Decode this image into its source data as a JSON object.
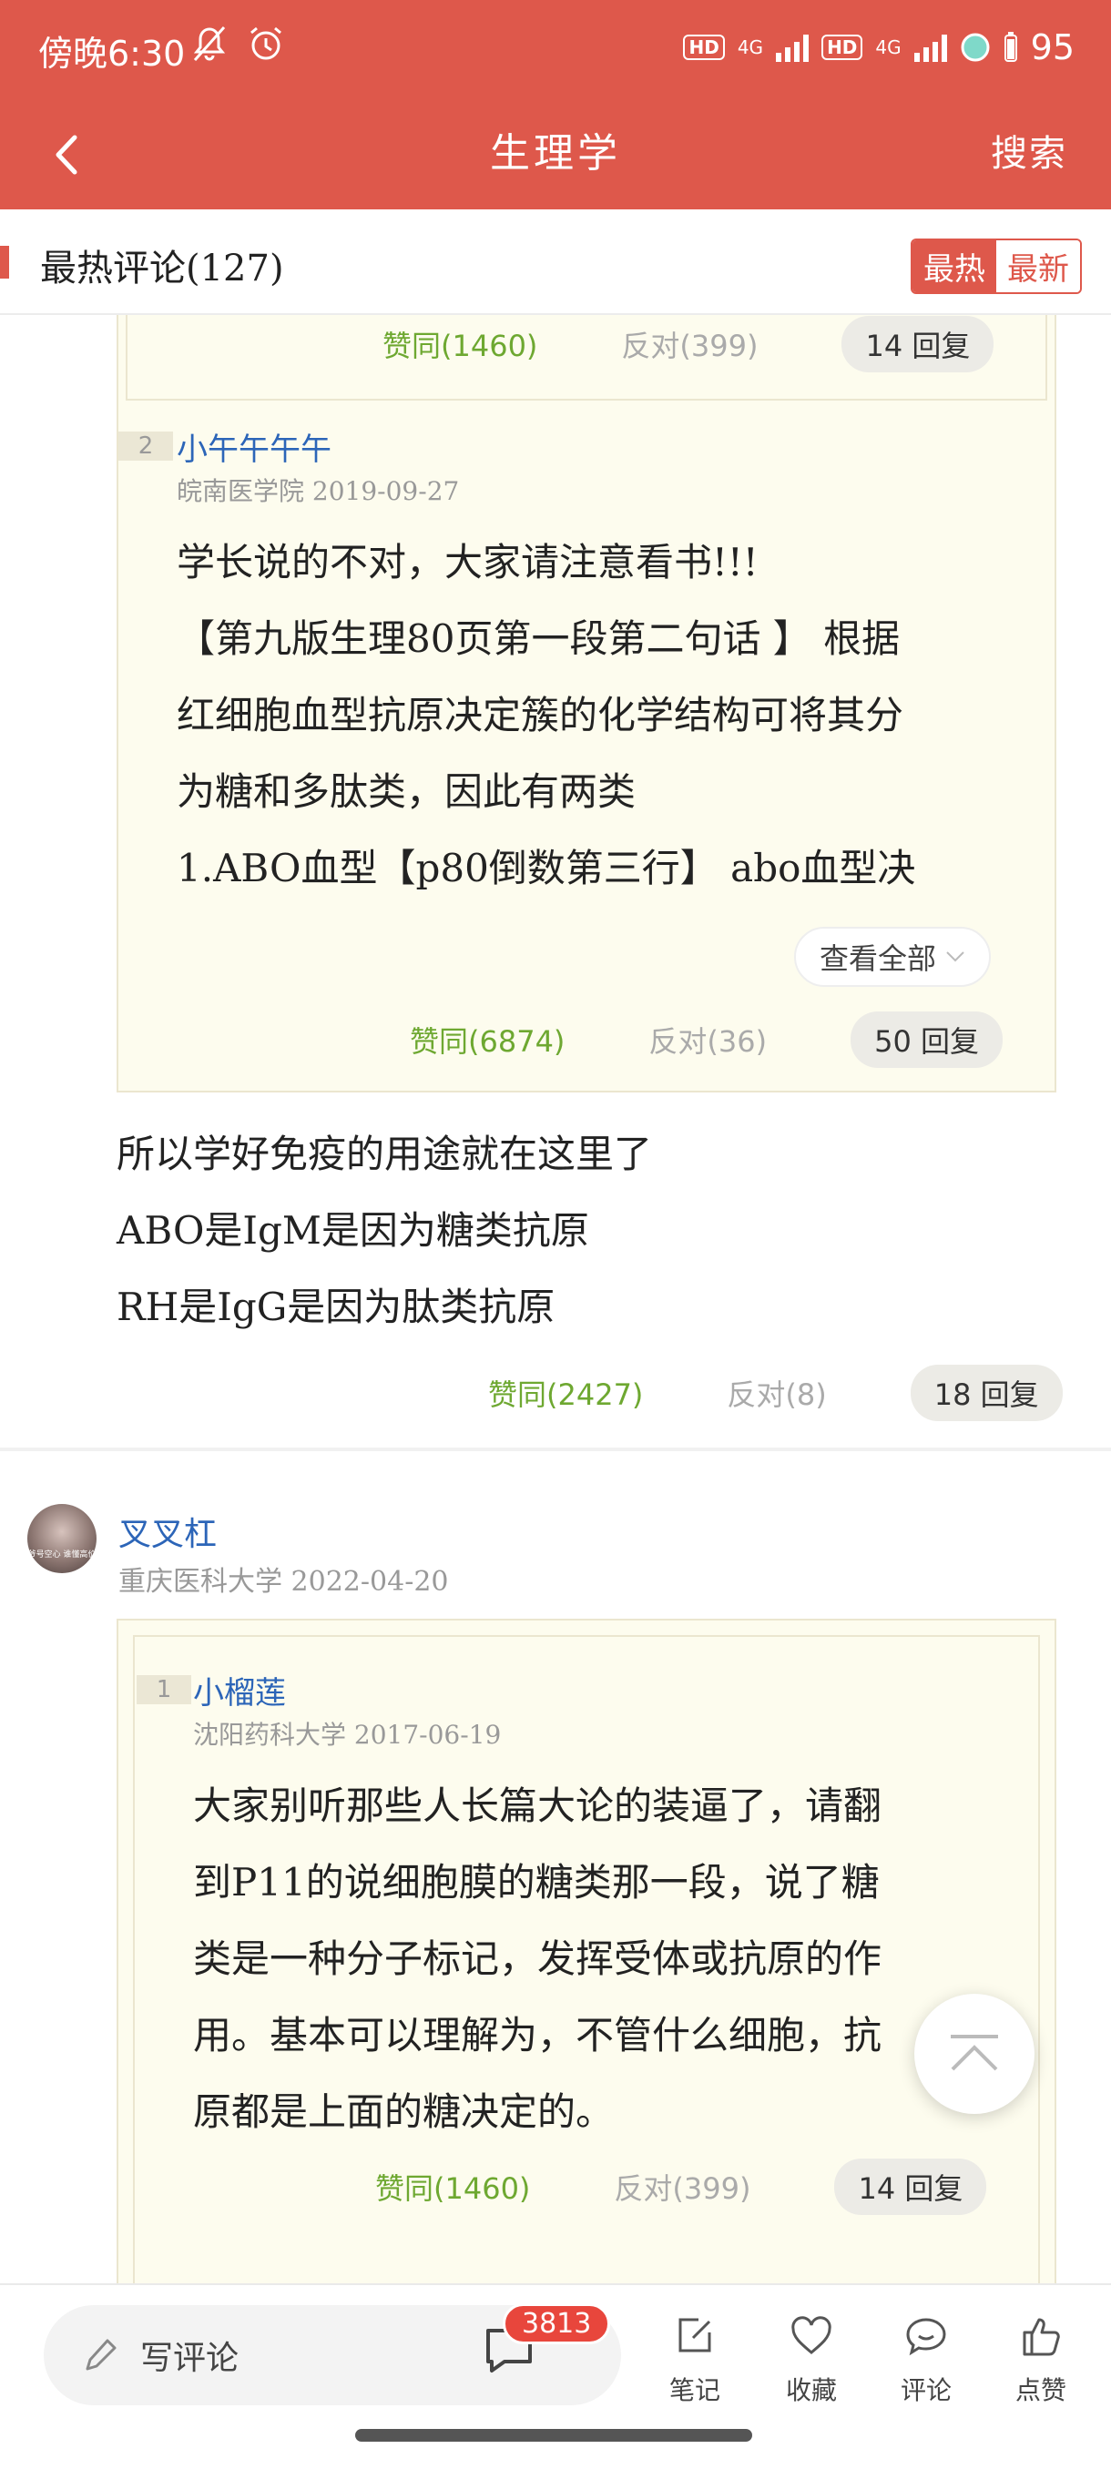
{
  "status_bar": {
    "time": "傍晚6:30",
    "hd1": "HD",
    "net1": "4G",
    "hd2": "HD",
    "net2": "4G",
    "battery": "95",
    "battery_icon": "battery-icon"
  },
  "header": {
    "title": "生理学",
    "search_label": "搜索",
    "background": "#de584b"
  },
  "section": {
    "title": "最热评论(127)",
    "tabs": [
      "最热",
      "最新"
    ],
    "active_tab": "最热"
  },
  "top_partial": {
    "agree": "赞同(1460)",
    "oppose": "反对(399)",
    "replies": "14 回复"
  },
  "quote2": {
    "floor": "2",
    "author": "小午午午午",
    "meta": "皖南医学院 2019-09-27",
    "lines": [
      "学长说的不对，大家请注意看书!!!",
      "【第九版生理80页第一段第二句话 】 根据",
      "红细胞血型抗原决定簇的化学结构可将其分",
      "为糖和多肽类，因此有两类",
      "1.ABO血型【p80倒数第三行】 abo血型决"
    ],
    "view_all": "查看全部",
    "agree": "赞同(6874)",
    "oppose": "反对(36)",
    "replies": "50 回复"
  },
  "comment1": {
    "lines": [
      "所以学好免疫的用途就在这里了",
      "ABO是IgM是因为糖类抗原",
      "RH是IgG是因为肽类抗原"
    ],
    "agree": "赞同(2427)",
    "oppose": "反对(8)",
    "replies": "18 回复"
  },
  "comment2": {
    "author": "叉叉杠",
    "meta": "重庆医科大学 2022-04-20",
    "quote": {
      "floor": "1",
      "author": "小榴莲",
      "meta": "沈阳药科大学 2017-06-19",
      "lines": [
        "大家别听那些人长篇大论的装逼了，请翻",
        "到P11的说细胞膜的糖类那一段，说了糖",
        "类是一种分子标记，发挥受体或抗原的作",
        "用。基本可以理解为，不管什么细胞，抗",
        "原都是上面的糖决定的。"
      ],
      "agree": "赞同(1460)",
      "oppose": "反对(399)",
      "replies": "14 回复"
    }
  },
  "bottom_bar": {
    "comment_placeholder": "写评论",
    "comment_count": "3813",
    "items": [
      {
        "label": "笔记",
        "icon": "note-edit-icon"
      },
      {
        "label": "收藏",
        "icon": "heart-icon"
      },
      {
        "label": "评论",
        "icon": "comment-icon"
      },
      {
        "label": "点赞",
        "icon": "thumbs-up-icon"
      }
    ]
  },
  "colors": {
    "agree": "#6ea831",
    "link": "#2c65b8",
    "quote_bg": "#fdfcee",
    "badge": "#e8463c"
  }
}
